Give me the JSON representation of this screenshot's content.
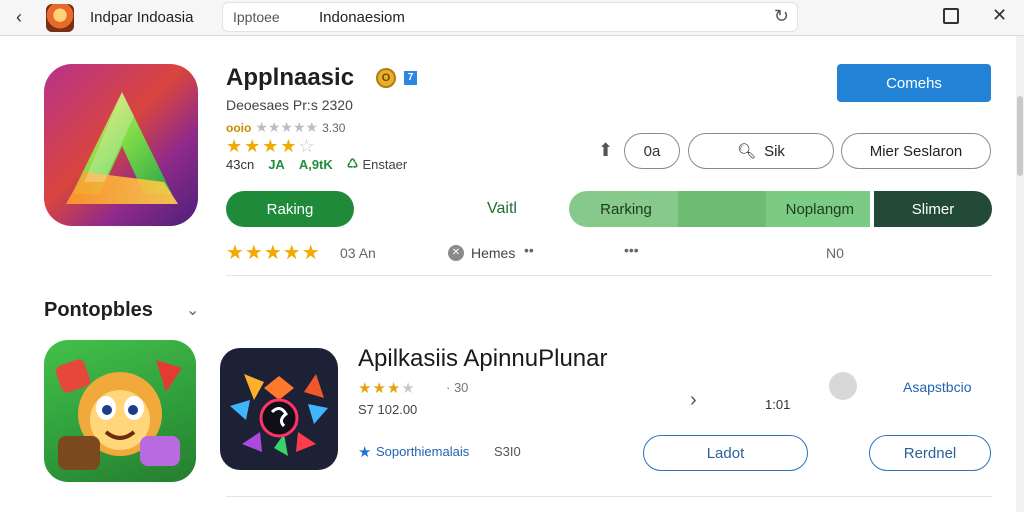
{
  "window": {
    "title": "Indpar Indoasia",
    "address_prefix": "Ipptoee",
    "address_text": "Indonaesiom",
    "back_icon": "arrow-left-icon",
    "reload_icon": "reload-icon",
    "maximize_icon": "maximize-icon",
    "close_icon": "close-icon"
  },
  "app": {
    "name": "Applnaasic",
    "badge_coin": "O",
    "badge_blue": "7",
    "developer_line": "Deoesaes Pr:s  2320",
    "small_rating_tag": "ooio",
    "small_rating_value": "3.30",
    "big_stars_filled": 4,
    "meta_count": "43cn",
    "meta_a": "JA",
    "meta_b": "A,9tK",
    "installer_label": "Enstaer",
    "stars_row_text": "03 An",
    "heres_label": "Hemes",
    "no_label": "N0",
    "colors": {
      "primary_blue": "#2283d6",
      "green_dark": "#1f8b3a",
      "green_light": "#86c98a",
      "green_mid": "#6cbd73",
      "forest": "#224a37",
      "star_gold": "#f2a900"
    }
  },
  "buttons": {
    "primary": "Comehs",
    "oa": "0a",
    "search": "Sik",
    "filter": "Mier Seslaron",
    "ranking_left": "Raking",
    "green_label": "Vaitl",
    "ranking_mid": "Rarking",
    "noplangm": "Noplangm",
    "slimer": "Slimer"
  },
  "section": {
    "title": "Pontopbles",
    "chevron_icon": "chevron-down-icon"
  },
  "app2": {
    "name": "Apilkasiis ApinnuPlunar",
    "stars_filled": 3,
    "stars_text": "30",
    "price": "S7 102.00",
    "time": "1:01",
    "link": "Asapstbcio",
    "support_label": "Soporthiemalais",
    "support_num": "S3I0",
    "btn_left": "Ladot",
    "btn_right": "Rerdnel"
  }
}
